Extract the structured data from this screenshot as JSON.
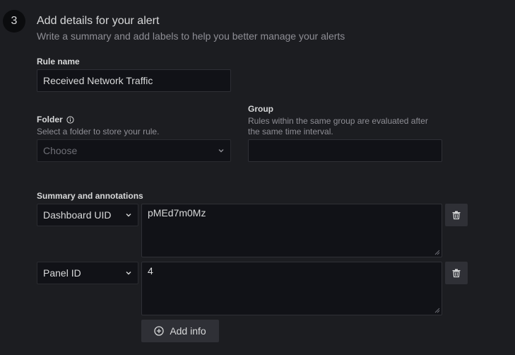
{
  "step": {
    "number": "3",
    "title": "Add details for your alert",
    "description": "Write a summary and add labels to help you better manage your alerts"
  },
  "rule_name": {
    "label": "Rule name",
    "value": "Received Network Traffic"
  },
  "folder": {
    "label": "Folder",
    "description": "Select a folder to store your rule.",
    "placeholder": "Choose",
    "icon": "info-circle-icon"
  },
  "group": {
    "label": "Group",
    "description_line1": "Rules within the same group are evaluated after",
    "description_line2": "the same time interval.",
    "value": ""
  },
  "annotations": {
    "label": "Summary and annotations",
    "items": [
      {
        "key": "Dashboard UID",
        "value": "pMEd7m0Mz"
      },
      {
        "key": "Panel ID",
        "value": "4"
      }
    ],
    "add_label": "Add info"
  },
  "colors": {
    "background": "#1c1d21",
    "input_bg": "#111217",
    "button_bg": "#2f3036",
    "text": "#d8d9da",
    "muted": "#8e8e95"
  }
}
